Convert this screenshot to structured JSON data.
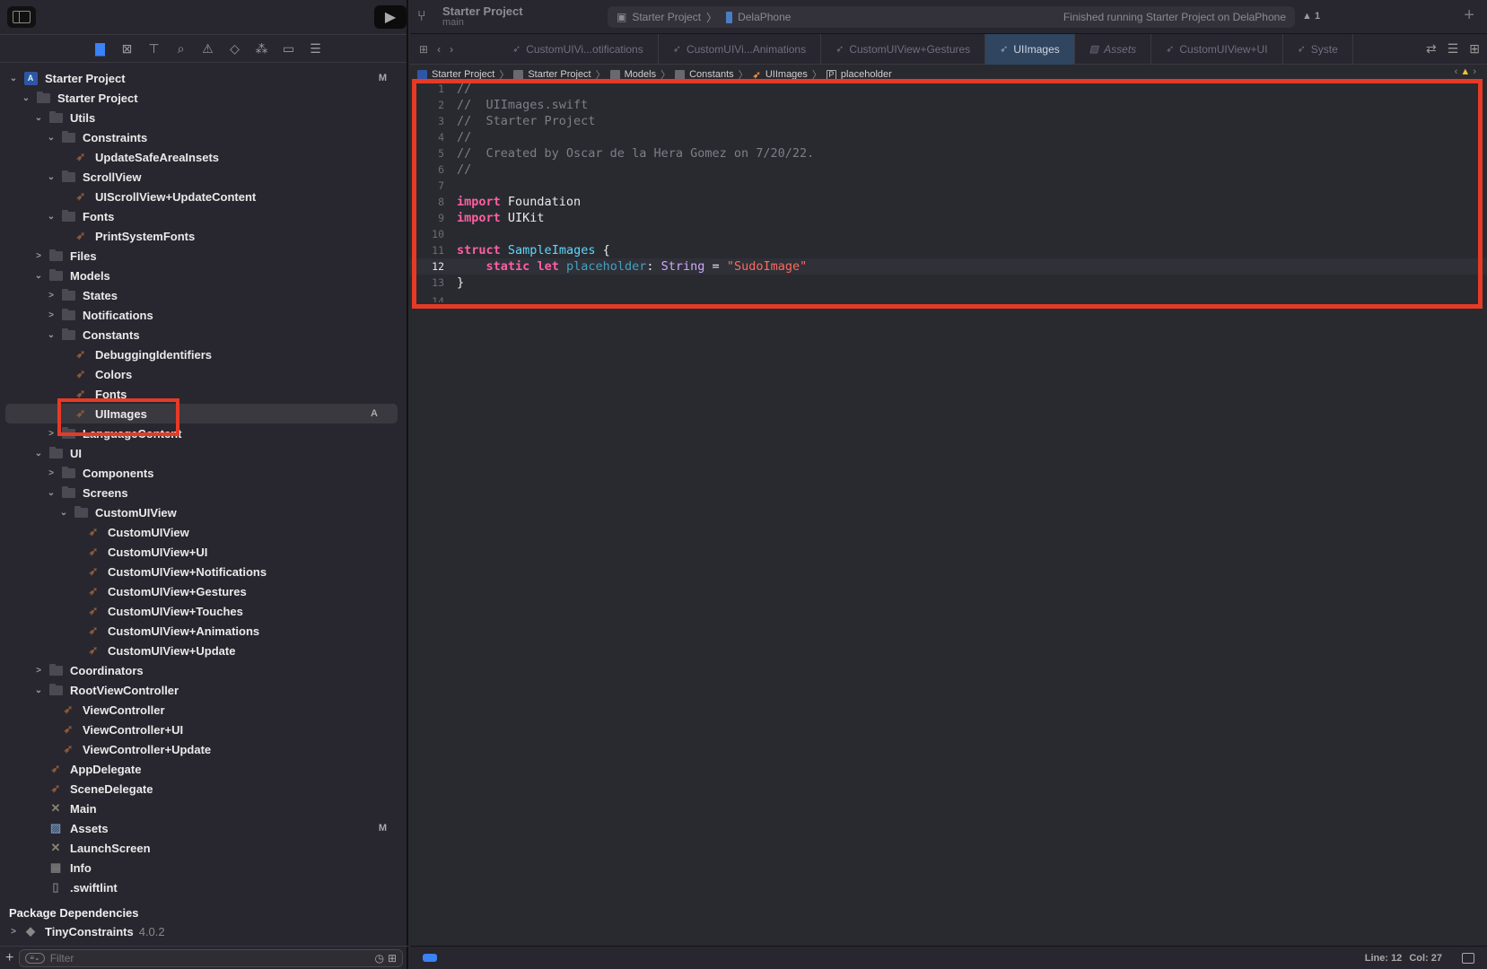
{
  "sidebar": {
    "nav_icons": [
      "folder-icon",
      "source-control-icon",
      "hierarchy-icon",
      "search-icon",
      "warning-icon",
      "test-icon",
      "debug-icon",
      "breakpoint-icon",
      "report-icon"
    ],
    "tree": [
      {
        "depth": 0,
        "chev": "down",
        "icon": "project",
        "label": "Starter Project",
        "badge": "M"
      },
      {
        "depth": 1,
        "chev": "down",
        "icon": "folder",
        "label": "Starter Project"
      },
      {
        "depth": 2,
        "chev": "down",
        "icon": "folder",
        "label": "Utils"
      },
      {
        "depth": 3,
        "chev": "down",
        "icon": "folder",
        "label": "Constraints"
      },
      {
        "depth": 4,
        "chev": "",
        "icon": "swift",
        "label": "UpdateSafeAreaInsets"
      },
      {
        "depth": 3,
        "chev": "down",
        "icon": "folder",
        "label": "ScrollView"
      },
      {
        "depth": 4,
        "chev": "",
        "icon": "swift",
        "label": "UIScrollView+UpdateContent"
      },
      {
        "depth": 3,
        "chev": "down",
        "icon": "folder",
        "label": "Fonts"
      },
      {
        "depth": 4,
        "chev": "",
        "icon": "swift",
        "label": "PrintSystemFonts"
      },
      {
        "depth": 2,
        "chev": "right",
        "icon": "folder",
        "label": "Files"
      },
      {
        "depth": 2,
        "chev": "down",
        "icon": "folder",
        "label": "Models"
      },
      {
        "depth": 3,
        "chev": "right",
        "icon": "folder",
        "label": "States"
      },
      {
        "depth": 3,
        "chev": "right",
        "icon": "folder",
        "label": "Notifications"
      },
      {
        "depth": 3,
        "chev": "down",
        "icon": "folder",
        "label": "Constants"
      },
      {
        "depth": 4,
        "chev": "",
        "icon": "swift",
        "label": "DebuggingIdentifiers"
      },
      {
        "depth": 4,
        "chev": "",
        "icon": "swift",
        "label": "Colors"
      },
      {
        "depth": 4,
        "chev": "",
        "icon": "swift",
        "label": "Fonts"
      },
      {
        "depth": 4,
        "chev": "",
        "icon": "swift",
        "label": "UIImages",
        "badge": "A",
        "selected": true
      },
      {
        "depth": 3,
        "chev": "right",
        "icon": "folder",
        "label": "LanguageContent"
      },
      {
        "depth": 2,
        "chev": "down",
        "icon": "folder",
        "label": "UI"
      },
      {
        "depth": 3,
        "chev": "right",
        "icon": "folder",
        "label": "Components"
      },
      {
        "depth": 3,
        "chev": "down",
        "icon": "folder",
        "label": "Screens"
      },
      {
        "depth": 4,
        "chev": "down",
        "icon": "folder",
        "label": "CustomUIView"
      },
      {
        "depth": 5,
        "chev": "",
        "icon": "swift",
        "label": "CustomUIView"
      },
      {
        "depth": 5,
        "chev": "",
        "icon": "swift",
        "label": "CustomUIView+UI"
      },
      {
        "depth": 5,
        "chev": "",
        "icon": "swift",
        "label": "CustomUIView+Notifications"
      },
      {
        "depth": 5,
        "chev": "",
        "icon": "swift",
        "label": "CustomUIView+Gestures"
      },
      {
        "depth": 5,
        "chev": "",
        "icon": "swift",
        "label": "CustomUIView+Touches"
      },
      {
        "depth": 5,
        "chev": "",
        "icon": "swift",
        "label": "CustomUIView+Animations"
      },
      {
        "depth": 5,
        "chev": "",
        "icon": "swift",
        "label": "CustomUIView+Update"
      },
      {
        "depth": 2,
        "chev": "right",
        "icon": "folder",
        "label": "Coordinators"
      },
      {
        "depth": 2,
        "chev": "down",
        "icon": "folder",
        "label": "RootViewController"
      },
      {
        "depth": 3,
        "chev": "",
        "icon": "swift",
        "label": "ViewController"
      },
      {
        "depth": 3,
        "chev": "",
        "icon": "swift",
        "label": "ViewController+UI"
      },
      {
        "depth": 3,
        "chev": "",
        "icon": "swift",
        "label": "ViewController+Update"
      },
      {
        "depth": 2,
        "chev": "",
        "icon": "swift",
        "label": "AppDelegate"
      },
      {
        "depth": 2,
        "chev": "",
        "icon": "swift",
        "label": "SceneDelegate"
      },
      {
        "depth": 2,
        "chev": "",
        "icon": "storyboard",
        "label": "Main"
      },
      {
        "depth": 2,
        "chev": "",
        "icon": "assets",
        "label": "Assets",
        "badge": "M"
      },
      {
        "depth": 2,
        "chev": "",
        "icon": "storyboard",
        "label": "LaunchScreen"
      },
      {
        "depth": 2,
        "chev": "",
        "icon": "plist",
        "label": "Info"
      },
      {
        "depth": 2,
        "chev": "",
        "icon": "file",
        "label": ".swiftlint"
      }
    ],
    "package_title": "Package Dependencies",
    "packages": [
      {
        "label": "TinyConstraints",
        "version": "4.0.2"
      }
    ],
    "filter_placeholder": "Filter"
  },
  "toolbar": {
    "project_title": "Starter Project",
    "branch": "main",
    "scheme": "Starter Project",
    "device": "DelaPhone",
    "status": "Finished running Starter Project on DelaPhone",
    "warning_count": "1"
  },
  "tabs": [
    {
      "label": "CustomUIVi...otifications",
      "kind": "swift"
    },
    {
      "label": "CustomUIVi...Animations",
      "kind": "swift"
    },
    {
      "label": "CustomUIView+Gestures",
      "kind": "swift"
    },
    {
      "label": "UIImages",
      "kind": "swift",
      "active": true
    },
    {
      "label": "Assets",
      "kind": "assets",
      "italic": true
    },
    {
      "label": "CustomUIView+UI",
      "kind": "swift"
    },
    {
      "label": "Syste",
      "kind": "swift"
    }
  ],
  "jumpbar": [
    "Starter Project",
    "Starter Project",
    "Models",
    "Constants",
    "UIImages",
    "placeholder"
  ],
  "code": [
    [
      [
        "cm",
        "//"
      ]
    ],
    [
      [
        "cm",
        "//  UIImages.swift"
      ]
    ],
    [
      [
        "cm",
        "//  Starter Project"
      ]
    ],
    [
      [
        "cm",
        "//"
      ]
    ],
    [
      [
        "cm",
        "//  Created by Oscar de la Hera Gomez on 7/20/22."
      ]
    ],
    [
      [
        "cm",
        "//"
      ]
    ],
    [],
    [
      [
        "kw",
        "import"
      ],
      [
        "plain",
        " Foundation"
      ]
    ],
    [
      [
        "kw",
        "import"
      ],
      [
        "plain",
        " UIKit"
      ]
    ],
    [],
    [
      [
        "kw",
        "struct"
      ],
      [
        "plain",
        " "
      ],
      [
        "ty",
        "SampleImages"
      ],
      [
        "plain",
        " {"
      ]
    ],
    [
      [
        "plain",
        "    "
      ],
      [
        "kw",
        "static"
      ],
      [
        "plain",
        " "
      ],
      [
        "kw",
        "let"
      ],
      [
        "plain",
        " "
      ],
      [
        "id",
        "placeholder"
      ],
      [
        "plain",
        ": "
      ],
      [
        "tyname",
        "String"
      ],
      [
        "plain",
        " = "
      ],
      [
        "str",
        "\"SudoImage\""
      ]
    ],
    [
      [
        "plain",
        "}"
      ]
    ]
  ],
  "current_line": 12,
  "status": {
    "line_label": "Line: 12",
    "col_label": "Col: 27"
  }
}
